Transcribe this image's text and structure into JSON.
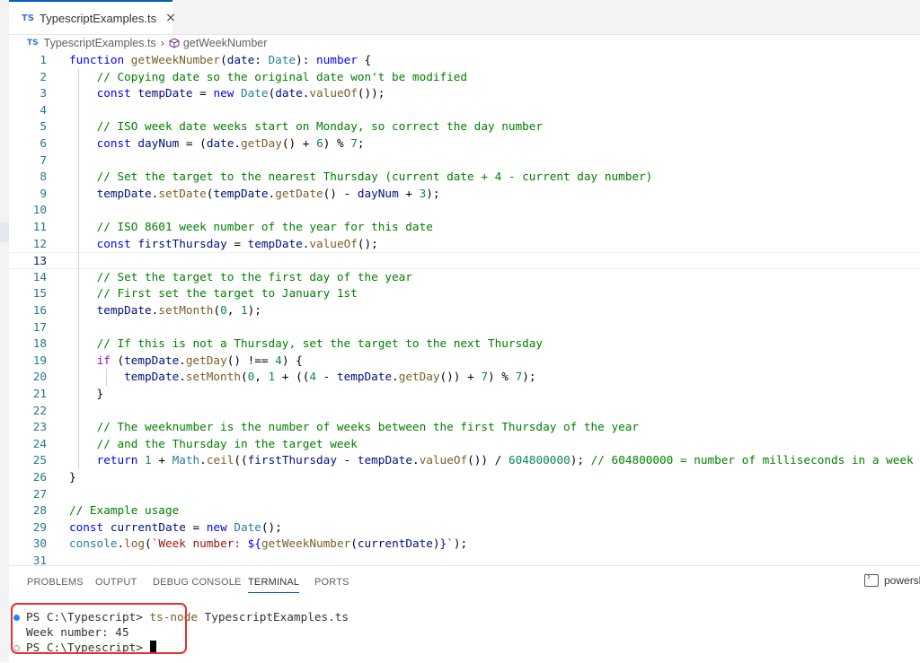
{
  "tab": {
    "badge": "TS",
    "title": "TypescriptExamples.ts",
    "close_icon": "×"
  },
  "breadcrumb": {
    "file": "TypescriptExamples.ts",
    "separator": "›",
    "symbol": "getWeekNumber"
  },
  "editor": {
    "current_line": 13,
    "lines": [
      {
        "num": "1",
        "text": "function getWeekNumber(date: Date): number {"
      },
      {
        "num": "2",
        "text": "    // Copying date so the original date won't be modified"
      },
      {
        "num": "3",
        "text": "    const tempDate = new Date(date.valueOf());"
      },
      {
        "num": "4",
        "text": ""
      },
      {
        "num": "5",
        "text": "    // ISO week date weeks start on Monday, so correct the day number"
      },
      {
        "num": "6",
        "text": "    const dayNum = (date.getDay() + 6) % 7;"
      },
      {
        "num": "7",
        "text": ""
      },
      {
        "num": "8",
        "text": "    // Set the target to the nearest Thursday (current date + 4 - current day number)"
      },
      {
        "num": "9",
        "text": "    tempDate.setDate(tempDate.getDate() - dayNum + 3);"
      },
      {
        "num": "10",
        "text": ""
      },
      {
        "num": "11",
        "text": "    // ISO 8601 week number of the year for this date"
      },
      {
        "num": "12",
        "text": "    const firstThursday = tempDate.valueOf();"
      },
      {
        "num": "13",
        "text": ""
      },
      {
        "num": "14",
        "text": "    // Set the target to the first day of the year"
      },
      {
        "num": "15",
        "text": "    // First set the target to January 1st"
      },
      {
        "num": "16",
        "text": "    tempDate.setMonth(0, 1);"
      },
      {
        "num": "17",
        "text": ""
      },
      {
        "num": "18",
        "text": "    // If this is not a Thursday, set the target to the next Thursday"
      },
      {
        "num": "19",
        "text": "    if (tempDate.getDay() !== 4) {"
      },
      {
        "num": "20",
        "text": "        tempDate.setMonth(0, 1 + ((4 - tempDate.getDay()) + 7) % 7);"
      },
      {
        "num": "21",
        "text": "    }"
      },
      {
        "num": "22",
        "text": ""
      },
      {
        "num": "23",
        "text": "    // The weeknumber is the number of weeks between the first Thursday of the year"
      },
      {
        "num": "24",
        "text": "    // and the Thursday in the target week"
      },
      {
        "num": "25",
        "text": "    return 1 + Math.ceil((firstThursday - tempDate.valueOf()) / 604800000); // 604800000 = number of milliseconds in a week"
      },
      {
        "num": "26",
        "text": "}"
      },
      {
        "num": "27",
        "text": ""
      },
      {
        "num": "28",
        "text": "// Example usage"
      },
      {
        "num": "29",
        "text": "const currentDate = new Date();"
      },
      {
        "num": "30",
        "text": "console.log(`Week number: ${getWeekNumber(currentDate)}`);"
      },
      {
        "num": "31",
        "text": ""
      }
    ]
  },
  "panel": {
    "tabs": [
      "PROBLEMS",
      "OUTPUT",
      "DEBUG CONSOLE",
      "TERMINAL",
      "PORTS"
    ],
    "active_tab": "TERMINAL",
    "shell_label": "powersh"
  },
  "terminal": {
    "prompt1": "PS C:\\Typescript>",
    "command": "ts-node",
    "command_arg": "TypescriptExamples.ts",
    "output": "Week number: 45",
    "prompt2": "PS C:\\Typescript>"
  },
  "colors": {
    "accent": "#005fb8",
    "highlight_box": "#e53030",
    "ts_badge": "#3178c6"
  }
}
